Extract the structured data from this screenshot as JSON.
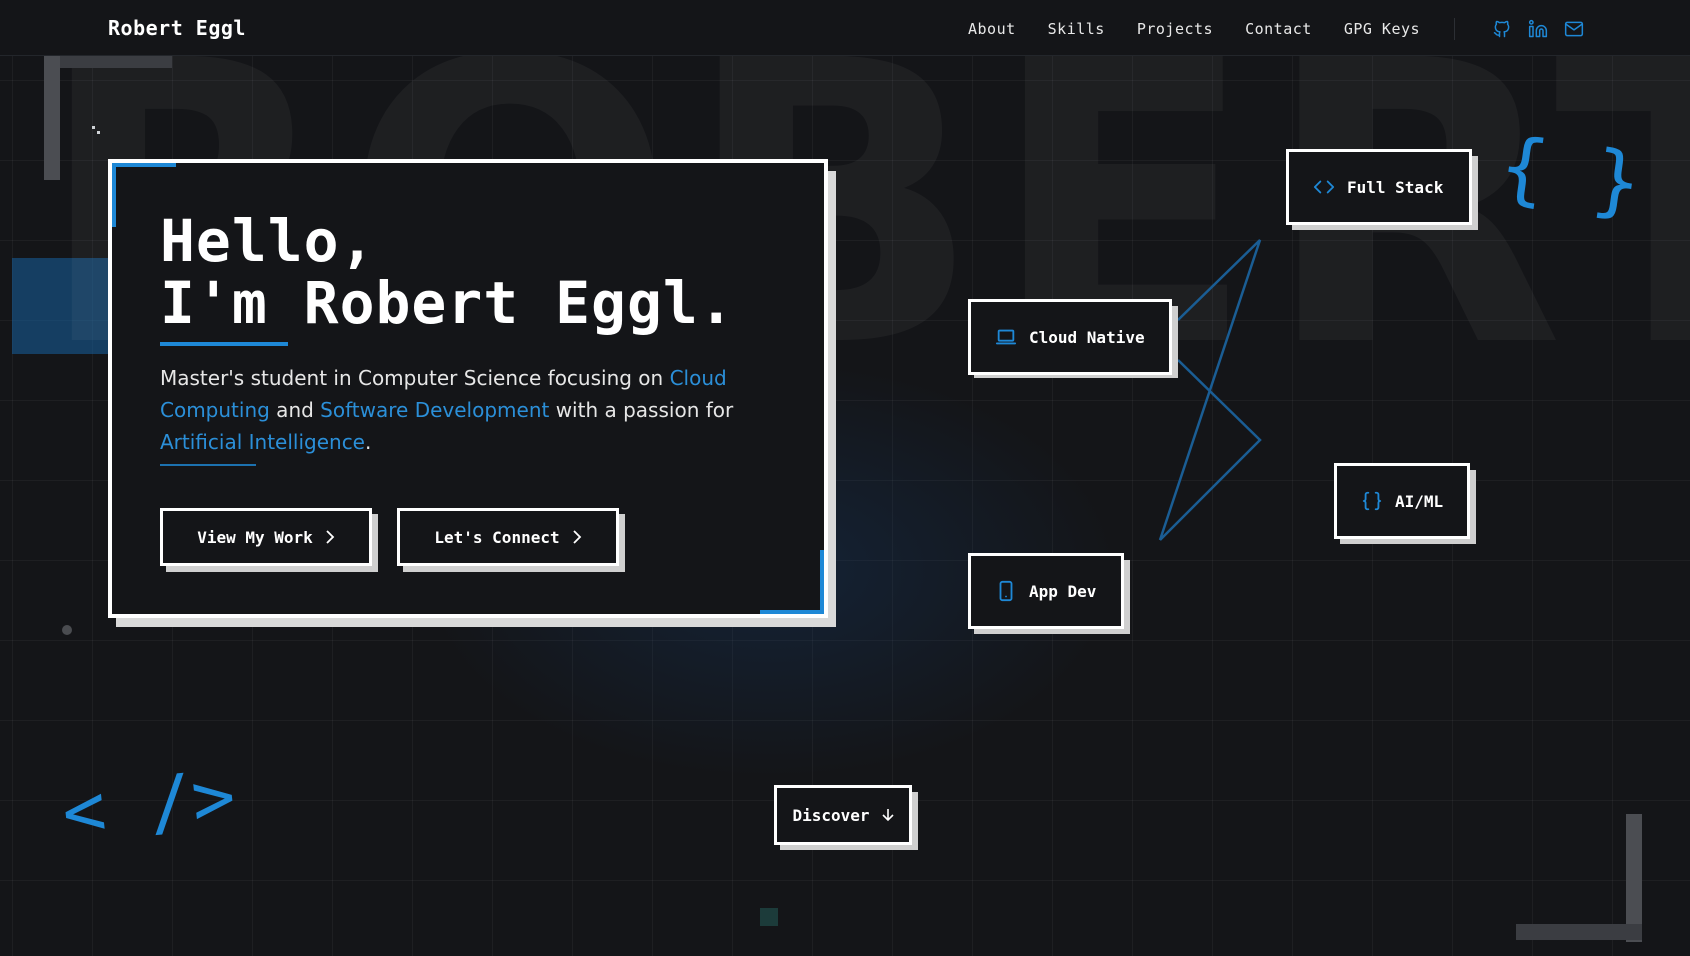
{
  "nav": {
    "logo": "Robert Eggl",
    "links": [
      "About",
      "Skills",
      "Projects",
      "Contact",
      "GPG Keys"
    ],
    "icons": [
      "github-icon",
      "linkedin-icon",
      "mail-icon"
    ]
  },
  "background": {
    "word": "ROBERT"
  },
  "hero": {
    "title_line1": "Hello,",
    "title_line2": "I'm Robert Eggl.",
    "desc_part1": "Master's student in Computer Science focusing on ",
    "desc_hl1": "Cloud Computing",
    "desc_part2": " and ",
    "desc_hl2": "Software Development",
    "desc_part3": " with a passion for ",
    "desc_hl3": "Artificial Intelligence",
    "desc_part4": ".",
    "btn_work": "View My Work",
    "btn_connect": "Let's Connect"
  },
  "tags": {
    "full_stack": "Full Stack",
    "cloud_native": "Cloud Native",
    "ai_ml": "AI/ML",
    "app_dev": "App Dev"
  },
  "discover": "Discover",
  "decor": {
    "braces": "{ }",
    "code": "< />"
  },
  "colors": {
    "accent": "#1e88d6",
    "background": "#141518",
    "text": "#ffffff"
  }
}
